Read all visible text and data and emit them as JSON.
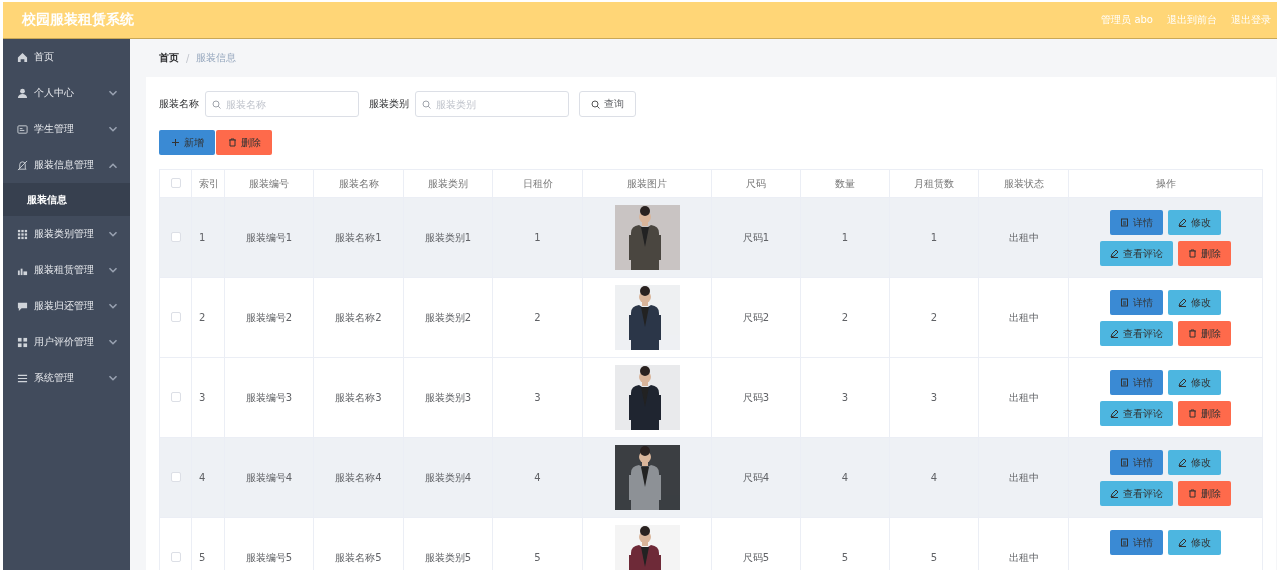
{
  "header": {
    "title": "校园服装租赁系统",
    "links": [
      "管理员 abo",
      "退出到前台",
      "退出登录"
    ]
  },
  "sidebar": {
    "items": [
      {
        "label": "首页",
        "expandable": false,
        "expanded": false
      },
      {
        "label": "个人中心",
        "expandable": true,
        "expanded": false
      },
      {
        "label": "学生管理",
        "expandable": true,
        "expanded": false
      },
      {
        "label": "服装信息管理",
        "expandable": true,
        "expanded": true,
        "children": [
          {
            "label": "服装信息",
            "selected": true
          }
        ]
      },
      {
        "label": "服装类别管理",
        "expandable": true,
        "expanded": false
      },
      {
        "label": "服装租赁管理",
        "expandable": true,
        "expanded": false
      },
      {
        "label": "服装归还管理",
        "expandable": true,
        "expanded": false
      },
      {
        "label": "用户评价管理",
        "expandable": true,
        "expanded": false
      },
      {
        "label": "系统管理",
        "expandable": true,
        "expanded": false
      }
    ]
  },
  "breadcrumb": {
    "separator": "/",
    "items": [
      "首页",
      "服装信息"
    ]
  },
  "search": {
    "fields": [
      {
        "label": "服装名称",
        "placeholder": "服装名称"
      },
      {
        "label": "服装类别",
        "placeholder": "服装类别"
      }
    ],
    "button": "查询"
  },
  "toolbar": [
    {
      "label": "新增",
      "kind": "add"
    },
    {
      "label": "删除",
      "kind": "delete"
    }
  ],
  "table": {
    "header_checked": false,
    "columns": [
      "索引",
      "服装编号",
      "服装名称",
      "服装类别",
      "日租价",
      "服装图片",
      "尺码",
      "数量",
      "月租赁数",
      "服装状态",
      "操作"
    ],
    "rows": [
      {
        "checked": false,
        "shaded": true,
        "cells": [
          "1",
          "服装编号1",
          "服装名称1",
          "服装类别1",
          "1"
        ],
        "image": {
          "kind": "picture"
        },
        "cells_after": [
          "尺码1",
          "1",
          "1",
          "出租中"
        ],
        "actions": [
          {
            "label": "详情",
            "kind": "detail"
          },
          {
            "label": "修改",
            "kind": "edit"
          },
          {
            "label": "查看评论",
            "kind": "review"
          },
          {
            "label": "删除",
            "kind": "delete"
          }
        ]
      },
      {
        "checked": false,
        "shaded": false,
        "cells": [
          "2",
          "服装编号2",
          "服装名称2",
          "服装类别2",
          "2"
        ],
        "image": {
          "kind": "picture"
        },
        "cells_after": [
          "尺码2",
          "2",
          "2",
          "出租中"
        ],
        "actions": [
          {
            "label": "详情",
            "kind": "detail"
          },
          {
            "label": "修改",
            "kind": "edit"
          },
          {
            "label": "查看评论",
            "kind": "review"
          },
          {
            "label": "删除",
            "kind": "delete"
          }
        ]
      },
      {
        "checked": false,
        "shaded": false,
        "cells": [
          "3",
          "服装编号3",
          "服装名称3",
          "服装类别3",
          "3"
        ],
        "image": {
          "kind": "picture"
        },
        "cells_after": [
          "尺码3",
          "3",
          "3",
          "出租中"
        ],
        "actions": [
          {
            "label": "详情",
            "kind": "detail"
          },
          {
            "label": "修改",
            "kind": "edit"
          },
          {
            "label": "查看评论",
            "kind": "review"
          },
          {
            "label": "删除",
            "kind": "delete"
          }
        ]
      },
      {
        "checked": false,
        "shaded": true,
        "cells": [
          "4",
          "服装编号4",
          "服装名称4",
          "服装类别4",
          "4"
        ],
        "image": {
          "kind": "picture"
        },
        "cells_after": [
          "尺码4",
          "4",
          "4",
          "出租中"
        ],
        "actions": [
          {
            "label": "详情",
            "kind": "detail"
          },
          {
            "label": "修改",
            "kind": "edit"
          },
          {
            "label": "查看评论",
            "kind": "review"
          },
          {
            "label": "删除",
            "kind": "delete"
          }
        ]
      },
      {
        "checked": false,
        "shaded": false,
        "cells": [
          "5",
          "服装编号5",
          "服装名称5",
          "服装类别5",
          "5"
        ],
        "image": {
          "kind": "picture"
        },
        "cells_after": [
          "尺码5",
          "5",
          "5",
          "出租中"
        ],
        "actions": [
          {
            "label": "详情",
            "kind": "detail"
          },
          {
            "label": "修改",
            "kind": "edit"
          }
        ]
      }
    ]
  }
}
